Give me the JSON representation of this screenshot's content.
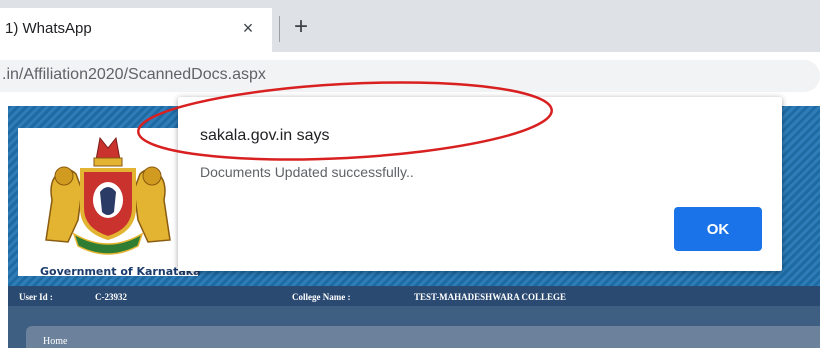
{
  "browser": {
    "tab_title": "1) WhatsApp",
    "close_glyph": "×",
    "new_tab_glyph": "+",
    "url": ".in/Affiliation2020/ScannedDocs.aspx"
  },
  "page": {
    "government_label": "Government of Karnataka",
    "user_id_label": "User Id :",
    "user_id_value": "C-23932",
    "college_name_label": "College Name :",
    "college_name_value": "TEST-MAHADESHWARA COLLEGE",
    "nav_home": "Home"
  },
  "dialog": {
    "title": "sakala.gov.in says",
    "message": "Documents Updated successfully..",
    "ok_label": "OK"
  },
  "colors": {
    "ok_button": "#1a73e8",
    "banner": "#1e6aa3",
    "annotation_ellipse": "#d92020"
  },
  "icons": {
    "tab_close": "close-icon",
    "new_tab": "plus-icon",
    "emblem": "karnataka-emblem"
  }
}
